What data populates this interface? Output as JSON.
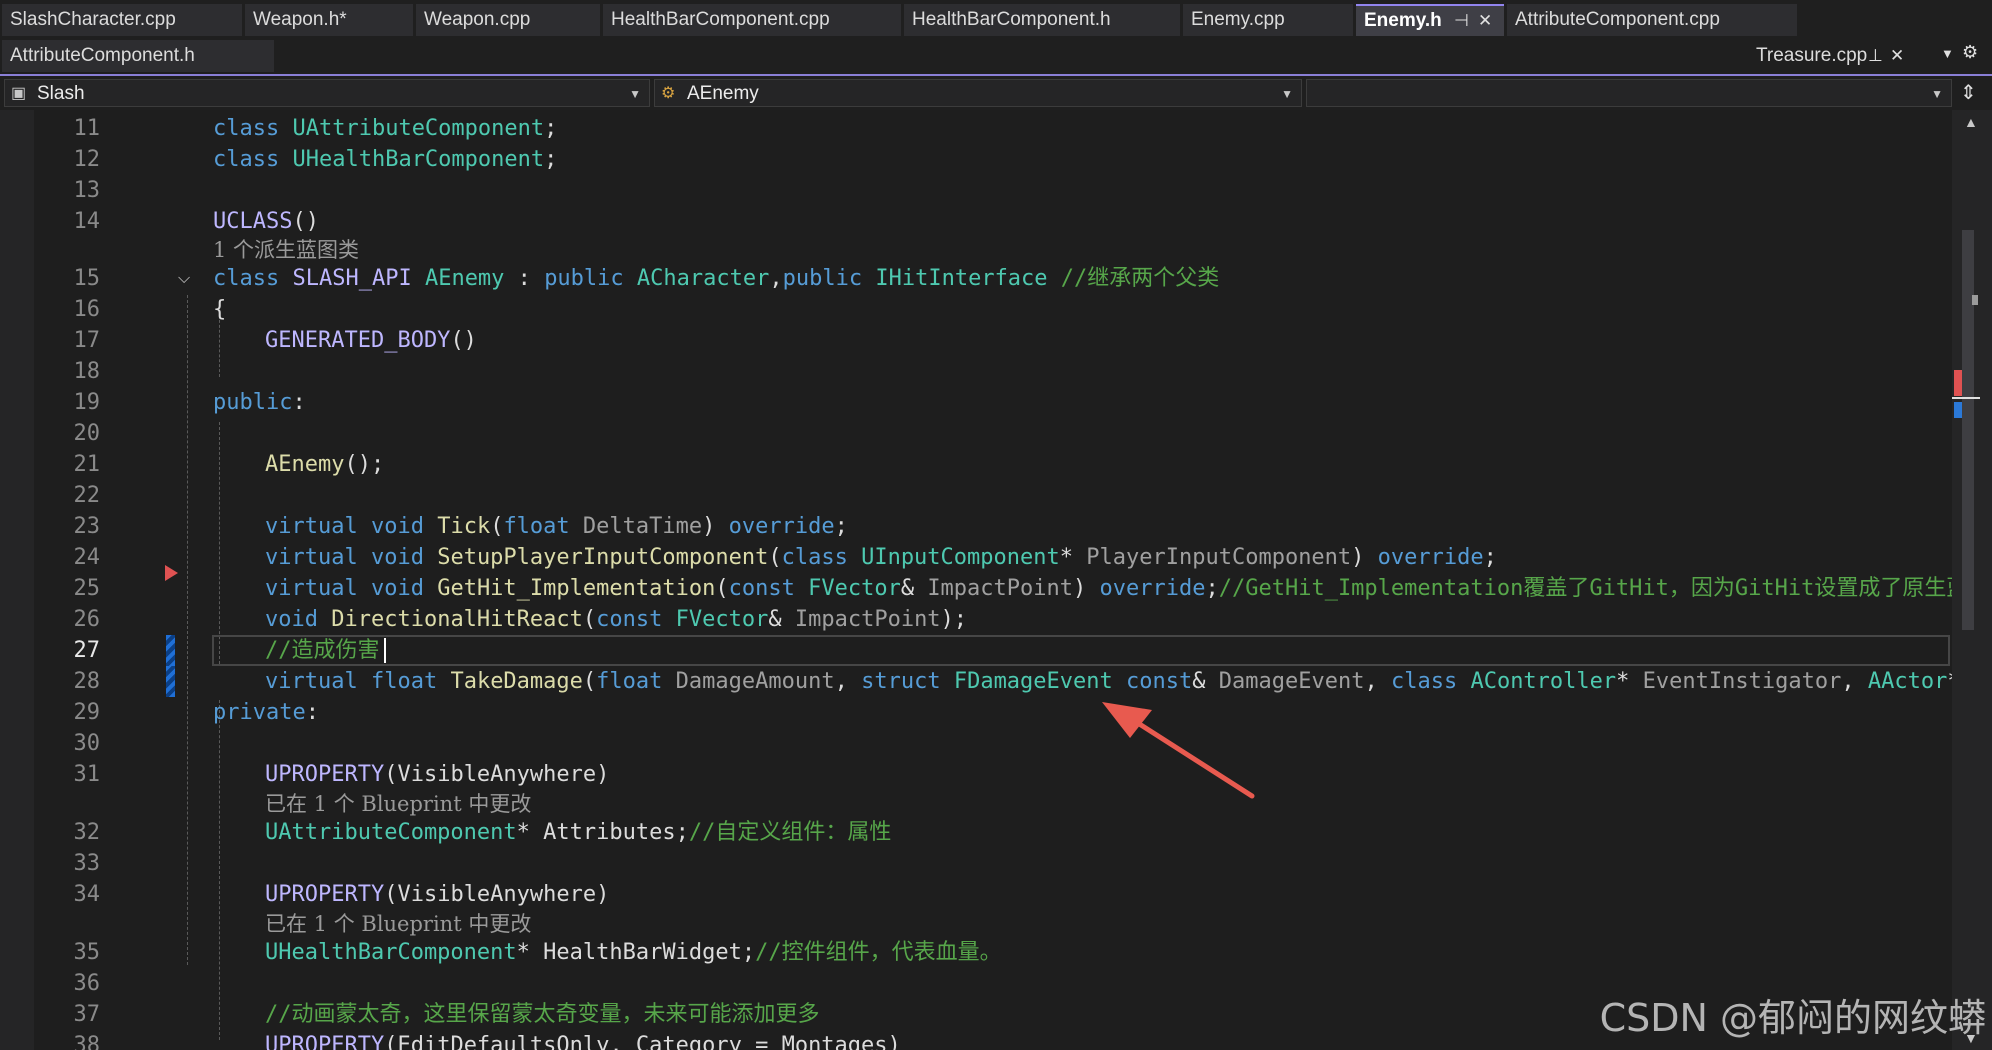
{
  "tabs_row1": [
    {
      "label": "SlashCharacter.cpp"
    },
    {
      "label": "Weapon.h*"
    },
    {
      "label": "Weapon.cpp"
    },
    {
      "label": "HealthBarComponent.cpp"
    },
    {
      "label": "HealthBarComponent.h"
    },
    {
      "label": "Enemy.cpp"
    },
    {
      "label": "Enemy.h",
      "active": true
    },
    {
      "label": "AttributeComponent.cpp"
    }
  ],
  "tabs_row2": [
    {
      "label": "AttributeComponent.h"
    },
    {
      "label": "Treasure.cpp",
      "pinned": true
    }
  ],
  "tab_icons": {
    "pin": "pin-icon",
    "close": "close-icon",
    "overflow": "chevron-down-icon",
    "settings": "gear-icon"
  },
  "navbar": {
    "project": "Slash",
    "scope": "AEnemy",
    "member": ""
  },
  "editor": {
    "line_numbers": [
      "11",
      "12",
      "13",
      "14",
      "15",
      "16",
      "17",
      "18",
      "19",
      "20",
      "21",
      "22",
      "23",
      "24",
      "25",
      "26",
      "27",
      "28",
      "29",
      "30",
      "31",
      "32",
      "33",
      "34",
      "35",
      "36",
      "37",
      "38"
    ],
    "current_line": "27",
    "codelens": {
      "derived_blueprints": "1 个派生蓝图类",
      "blueprint_changed": "已在 1 个 Blueprint 中更改"
    },
    "lines": {
      "l11": [
        "class",
        " ",
        "UAttributeComponent",
        ";"
      ],
      "l12": [
        "class",
        " ",
        "UHealthBarComponent",
        ";"
      ],
      "l14": [
        "UCLASS",
        "()"
      ],
      "l15": [
        "class",
        " ",
        "SLASH_API",
        " ",
        "AEnemy",
        " : ",
        "public",
        " ",
        "ACharacter",
        ",",
        "public",
        " ",
        "IHitInterface",
        " ",
        "//继承两个父类"
      ],
      "l16": [
        "{"
      ],
      "l17": [
        "GENERATED_BODY",
        "()"
      ],
      "l19": [
        "public",
        ":"
      ],
      "l21": [
        "AEnemy",
        "();"
      ],
      "l23": [
        "virtual",
        " ",
        "void",
        " ",
        "Tick",
        "(",
        "float",
        " ",
        "DeltaTime",
        ") ",
        "override",
        ";"
      ],
      "l24": [
        "virtual",
        " ",
        "void",
        " ",
        "SetupPlayerInputComponent",
        "(",
        "class",
        " ",
        "UInputComponent",
        "* ",
        "PlayerInputComponent",
        ") ",
        "override",
        ";"
      ],
      "l25": [
        "virtual",
        " ",
        "void",
        " ",
        "GetHit_Implementation",
        "(",
        "const",
        " ",
        "FVector",
        "& ",
        "ImpactPoint",
        ") ",
        "override",
        ";",
        "//GetHit_Implementation覆盖了GitHit，因为GitHit设置成了原生蓝"
      ],
      "l26": [
        "void",
        " ",
        "DirectionalHitReact",
        "(",
        "const",
        " ",
        "FVector",
        "& ",
        "ImpactPoint",
        ");"
      ],
      "l27": [
        "//造成伤害"
      ],
      "l28": [
        "virtual",
        " ",
        "float",
        " ",
        "TakeDamage",
        "(",
        "float",
        " ",
        "DamageAmount",
        ", ",
        "struct",
        " ",
        "FDamageEvent",
        " ",
        "const",
        "& ",
        "DamageEvent",
        ", ",
        "class",
        " ",
        "AController",
        "* ",
        "EventInstigator",
        ", ",
        "AActor",
        "* D"
      ],
      "l29": [
        "private",
        ":"
      ],
      "l31": [
        "UPROPERTY",
        "(VisibleAnywhere)"
      ],
      "l32": [
        "UAttributeComponent",
        "* ",
        "Attributes",
        ";",
        "//自定义组件：属性"
      ],
      "l34": [
        "UPROPERTY",
        "(VisibleAnywhere)"
      ],
      "l35": [
        "UHealthBarComponent",
        "* ",
        "HealthBarWidget",
        ";",
        "//控件组件，代表血量。"
      ],
      "l37": [
        "//动画蒙太奇，这里保留蒙太奇变量，未来可能添加更多"
      ],
      "l38": [
        "UPROPERTY",
        "(EditDefaultsOnly, Category = Montages)"
      ]
    }
  },
  "annotation_arrow_color": "#e85a4f",
  "watermark": "CSDN @郁闷的网纹蟒"
}
